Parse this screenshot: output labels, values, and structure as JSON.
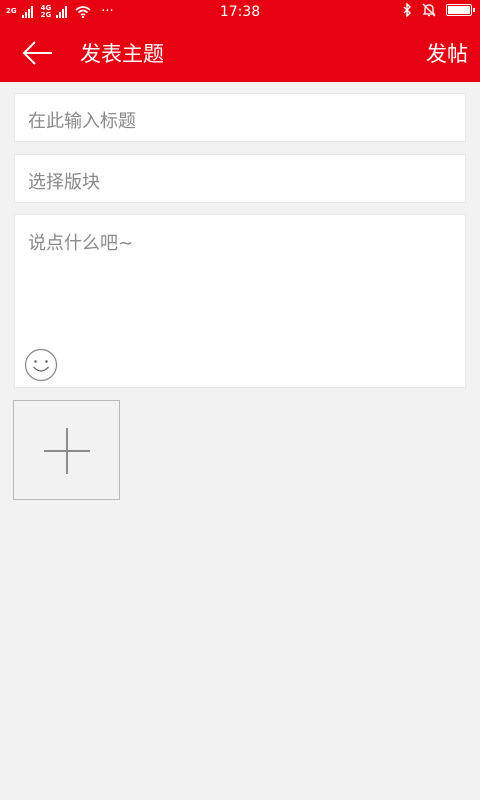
{
  "status_bar": {
    "time": "17:38",
    "sim1": "2G",
    "sim2_top": "4G",
    "sim2_bottom": "2G",
    "more": "···",
    "icons": [
      "signal-icon",
      "wifi-icon",
      "bluetooth-icon",
      "alarm-off-icon",
      "battery-icon"
    ]
  },
  "header": {
    "title": "发表主题",
    "post_label": "发帖",
    "background_color": "#e60012"
  },
  "form": {
    "title_placeholder": "在此输入标题",
    "board_placeholder": "选择版块",
    "content_placeholder": "说点什么吧~"
  },
  "icons": {
    "back": "arrow-left-icon",
    "emoji": "smiley-icon",
    "add_image": "plus-icon"
  }
}
